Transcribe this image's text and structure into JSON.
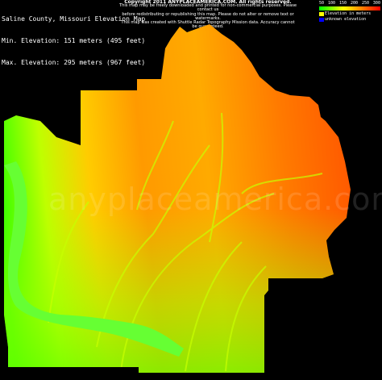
{
  "map": {
    "title": "Saline County, Missouri Elevation Map",
    "min_elevation": "Min. Elevation: 151 meters (495 feet)",
    "max_elevation": "Max. Elevation: 295 meters (967 feet)",
    "copyright": {
      "header": "Copyright 2011 ANYPLACEAMERICA.COM.  All rights reserved.",
      "lines": [
        "This map may be freely downloaded and printed for non-commercial purposes. Please contact us",
        "before redistributing or republishing this map.  Please do not alter or remove text or watermarks.",
        "This map was created with Shuttle Radar Topography Mission data.  Accuracy cannot be guaranteed."
      ]
    },
    "legend": {
      "ticks": [
        "50",
        "100",
        "150",
        "200",
        "250",
        "300"
      ],
      "elevation_label": "Elevation in meters",
      "unknown_label": "unknown elevation",
      "unknown_color": "#0000ff"
    },
    "watermark": "anyplaceamerica.com",
    "colors": {
      "low": "#00ff00",
      "mid": "#ffff00",
      "high": "#ff4400",
      "background": "#000000"
    }
  }
}
